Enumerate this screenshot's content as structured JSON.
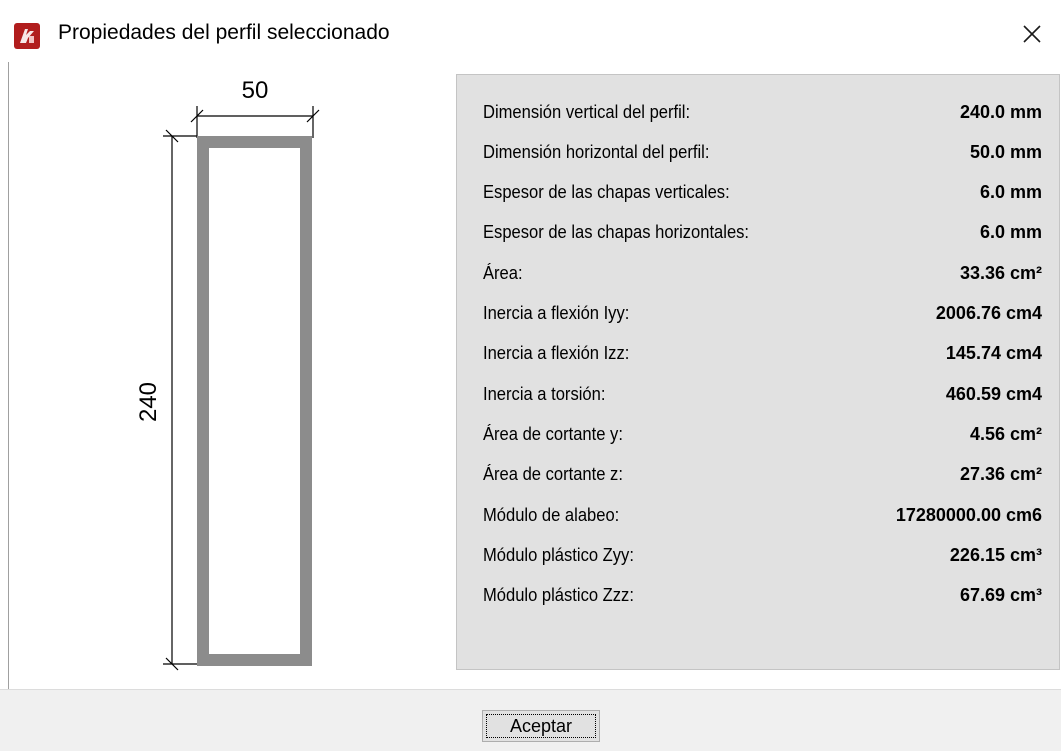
{
  "window": {
    "title": "Propiedades del perfil seleccionado",
    "close_icon": "close-icon",
    "app_icon": "app-icon"
  },
  "drawing": {
    "width_label": "50",
    "height_label": "240",
    "section_color": "#8c8c8c"
  },
  "properties": [
    {
      "label": "Dimensión vertical del perfil:",
      "value": "240.0 mm"
    },
    {
      "label": "Dimensión horizontal del perfil:",
      "value": "50.0 mm"
    },
    {
      "label": "Espesor de las chapas verticales:",
      "value": "6.0 mm"
    },
    {
      "label": "Espesor de las chapas horizontales:",
      "value": "6.0 mm"
    },
    {
      "label": "Área:",
      "value": "33.36 cm²"
    },
    {
      "label": "Inercia a flexión Iyy:",
      "value": "2006.76 cm4"
    },
    {
      "label": "Inercia a flexión Izz:",
      "value": "145.74 cm4"
    },
    {
      "label": "Inercia a torsión:",
      "value": "460.59 cm4"
    },
    {
      "label": "Área de cortante y:",
      "value": "4.56 cm²"
    },
    {
      "label": "Área de cortante z:",
      "value": "27.36 cm²"
    },
    {
      "label": "Módulo de alabeo:",
      "value": "17280000.00 cm6"
    },
    {
      "label": "Módulo plástico Zyy:",
      "value": "226.15 cm³"
    },
    {
      "label": "Módulo plástico Zzz:",
      "value": "67.69 cm³"
    }
  ],
  "footer": {
    "ok_label": "Aceptar"
  }
}
